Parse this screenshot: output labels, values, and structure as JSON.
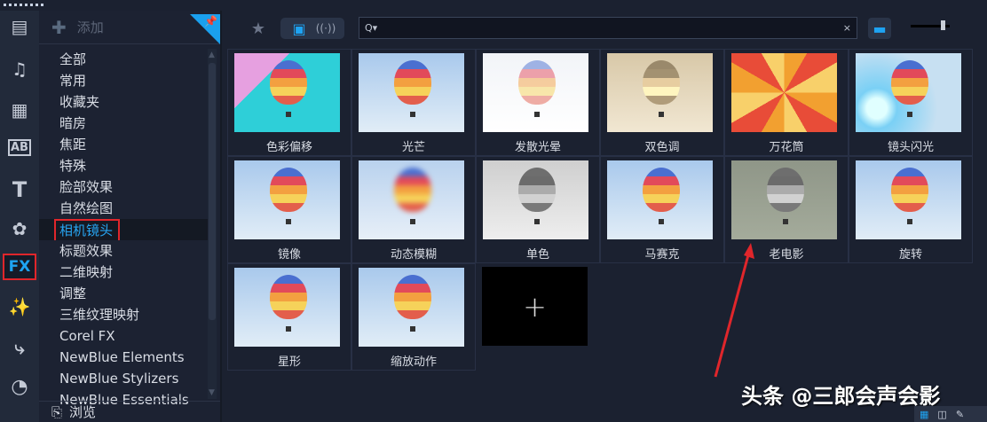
{
  "sidebar_icons": [
    "media-library-icon",
    "audio-icon",
    "transition-icon",
    "overlay-icon",
    "title-icon",
    "graphics-icon",
    "fx-icon",
    "magic-wand-icon",
    "path-icon",
    "speed-icon"
  ],
  "fx_label": "FX",
  "category_panel": {
    "add_label": "添加",
    "browse_label": "浏览",
    "items": [
      "全部",
      "常用",
      "收藏夹",
      "暗房",
      "焦距",
      "特殊",
      "脸部效果",
      "自然绘图",
      "相机镜头",
      "标题效果",
      "二维映射",
      "调整",
      "三维纹理映射",
      "Corel FX",
      "NewBlue Elements",
      "NewBlue Stylizers",
      "NewBlue Essentials"
    ],
    "selected": "相机镜头"
  },
  "search": {
    "value": "",
    "icon": "Q▾",
    "clear": "×"
  },
  "effects": [
    {
      "label": "色彩偏移",
      "bg": "linear-gradient(135deg,#e6a0e0 0 30%,#2ecfd8 30%)"
    },
    {
      "label": "光芒",
      "bg": "linear-gradient(#a9c9ec,#e1edf7)"
    },
    {
      "label": "发散光晕",
      "bg": "linear-gradient(#f2f4f8,#ffffff)"
    },
    {
      "label": "双色调",
      "bg": "linear-gradient(#d8c8a8,#f1e7d2)"
    },
    {
      "label": "万花筒",
      "bg": "repeating-conic-gradient(#f2a030 0 30deg,#e84c38 30deg 60deg,#f8d06a 60deg 90deg)"
    },
    {
      "label": "镜头闪光",
      "bg": "radial-gradient(circle at 20% 70%,#e0ffff 0 10%,#7ad0f5 20%,#c7e0f2 60%)"
    },
    {
      "label": "镜像",
      "bg": "linear-gradient(#a9c9ec,#e1edf7)"
    },
    {
      "label": "动态模糊",
      "bg": "linear-gradient(#b9d2ee,#e7eff8)"
    },
    {
      "label": "单色",
      "bg": "linear-gradient(#cfcfcf,#eeeeee)"
    },
    {
      "label": "马赛克",
      "bg": "linear-gradient(#a9c9ec,#e1edf7)"
    },
    {
      "label": "老电影",
      "bg": "linear-gradient(#8f9688,#a4ab9b)"
    },
    {
      "label": "旋转",
      "bg": "linear-gradient(#a9c9ec,#e1edf7)"
    },
    {
      "label": "星形",
      "bg": "linear-gradient(#a9c9ec,#e1edf7)"
    },
    {
      "label": "缩放动作",
      "bg": "linear-gradient(#a9c9ec,#e1edf7)"
    }
  ],
  "add_tile": "+",
  "watermark": "头条 @三郎会声会影",
  "colors": {
    "accent": "#1ea3f2",
    "highlight": "#e0262b",
    "background": "#1b2130"
  }
}
